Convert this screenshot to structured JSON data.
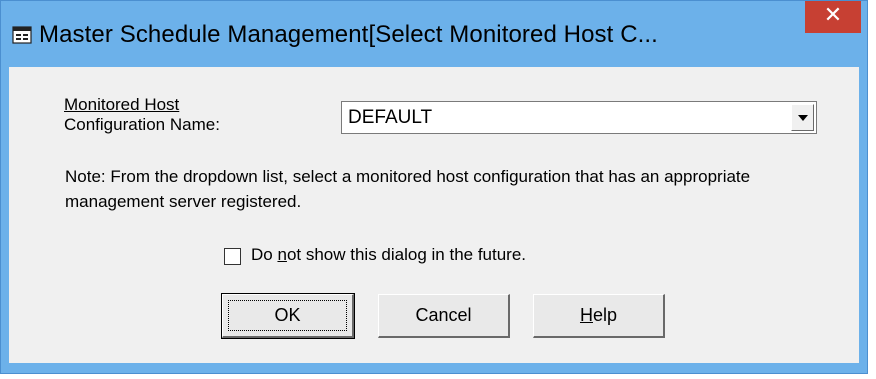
{
  "window": {
    "title": "Master Schedule Management[Select Monitored Host C...",
    "close_symbol": "✕",
    "icon": "app-window-icon"
  },
  "form": {
    "field_label_line1": "Monitored Host",
    "field_label_line2": "Configuration Name:",
    "combo_value": "DEFAULT",
    "note": "Note: From the dropdown list, select a monitored host configuration that has an appropriate management server registered.",
    "checkbox_label_pre": "Do ",
    "checkbox_label_mnemonic": "n",
    "checkbox_label_post": "ot show this dialog in the future.",
    "checkbox_checked": false
  },
  "buttons": {
    "ok_label": "OK",
    "cancel_label": "Cancel",
    "help_mnemonic": "H",
    "help_rest": "elp"
  },
  "colors": {
    "titlebar": "#6cb1ea",
    "close": "#c74033",
    "client": "#f0f0f0"
  }
}
